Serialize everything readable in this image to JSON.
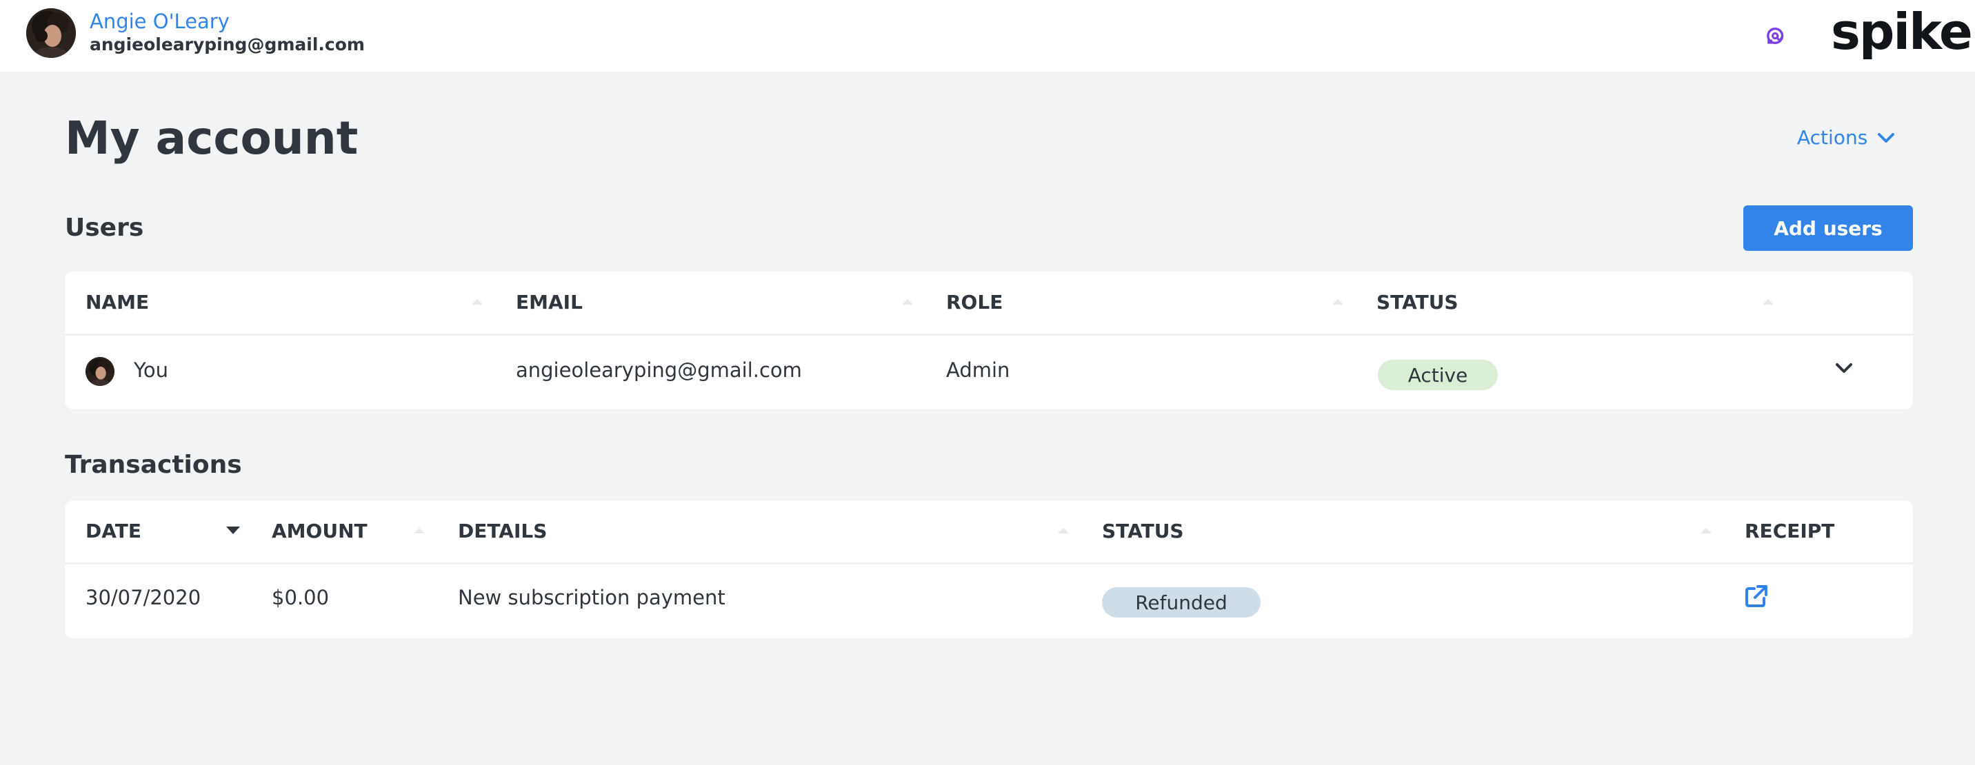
{
  "header": {
    "user_name": "Angie O'Leary",
    "user_email": "angieolearyping@gmail.com",
    "logo_text": "spike",
    "brand_color": "#7b3fe4"
  },
  "page": {
    "title": "My account",
    "actions_label": "Actions",
    "actions_icon": "chevron-down-icon"
  },
  "users": {
    "title": "Users",
    "add_button": "Add users",
    "columns": [
      "NAME",
      "EMAIL",
      "ROLE",
      "STATUS"
    ],
    "rows": [
      {
        "name": "You",
        "email": "angieolearyping@gmail.com",
        "role": "Admin",
        "status": "Active"
      }
    ]
  },
  "transactions": {
    "title": "Transactions",
    "columns": [
      "DATE",
      "AMOUNT",
      "DETAILS",
      "STATUS",
      "RECEIPT"
    ],
    "rows": [
      {
        "date": "30/07/2020",
        "amount": "$0.00",
        "details": "New subscription payment",
        "status": "Refunded",
        "receipt_icon": "external-link-icon"
      }
    ]
  },
  "colors": {
    "accent": "#3384e8",
    "active_badge": "#d9eed4",
    "refunded_badge": "#cfdde9",
    "background": "#f1f3f4"
  }
}
